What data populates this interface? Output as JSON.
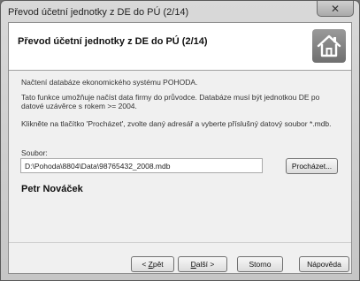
{
  "window": {
    "title": "Převod účetní jednotky z DE do PÚ (2/14)",
    "close_symbol": "✕"
  },
  "header": {
    "title": "Převod účetní jednotky z DE do PÚ (2/14)",
    "icon": "home-icon"
  },
  "content": {
    "p1": "Načtení databáze ekonomického systému POHODA.",
    "p2": "Tato funkce umožňuje načíst data firmy do průvodce. Databáze musí být jednotkou DE po datové uzávěrce s rokem >= 2004.",
    "p3": "Klikněte na tlačítko 'Procházet', zvolte daný adresář a vyberte příslušný datový soubor *.mdb.",
    "file_label": "Soubor:",
    "file_path": "D:\\Pohoda\\8804\\Data\\98765432_2008.mdb",
    "browse_label": "Procházet...",
    "user_name": "Petr Nováček"
  },
  "footer": {
    "back_prefix": "< ",
    "back_key": "Z",
    "back_rest": "pět",
    "next_key": "D",
    "next_rest": "alší >",
    "cancel_label": "Storno",
    "help_label": "Nápověda"
  }
}
